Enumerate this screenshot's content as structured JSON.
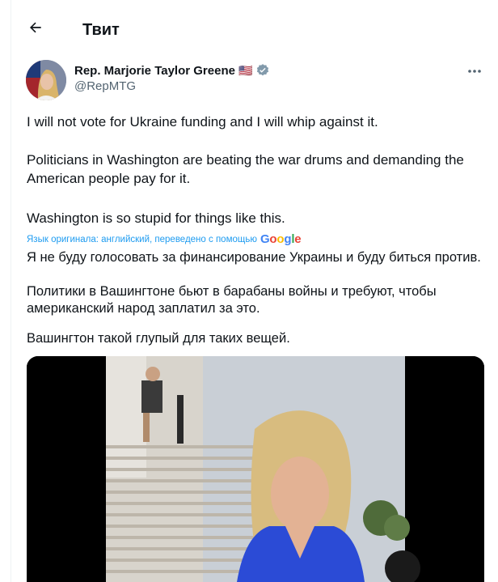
{
  "header": {
    "title": "Твит"
  },
  "tweet": {
    "author_name": "Rep. Marjorie Taylor Greene",
    "flag_emoji": "🇺🇸",
    "handle": "@RepMTG",
    "original_lines": [
      "I will not vote for Ukraine funding and I will whip against it.",
      "Politicians in Washington are beating the war drums and demanding the",
      "American people pay for it.",
      "Washington is so stupid for things like this."
    ],
    "translation_note": "Язык оригинала: английский, переведено с помощью",
    "translation_provider": "Google",
    "translated_lines": [
      "Я не буду голосовать за финансирование Украины и буду биться против.",
      "Политики в Вашингтоне бьют в барабаны войны и требуют, чтобы",
      "американский народ заплатил за это.",
      "Вашингтон такой глупый для таких вещей."
    ]
  },
  "colors": {
    "accent": "#1d9bf0",
    "text": "#0f1419",
    "secondary": "#536471",
    "verified": "#829aab"
  },
  "icons": {
    "back": "arrow-left-icon",
    "verified": "verified-badge-icon",
    "more": "more-horizontal-icon"
  }
}
